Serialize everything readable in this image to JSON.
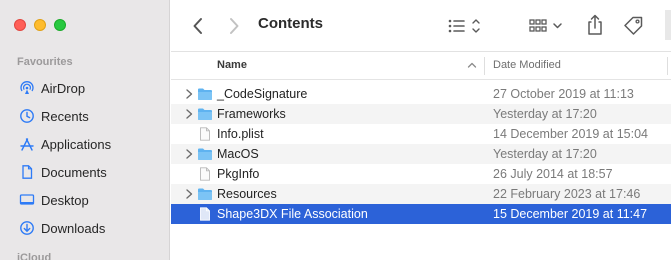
{
  "sidebar": {
    "section_title": "Favourites",
    "items": [
      {
        "label": "AirDrop",
        "icon": "airdrop-icon"
      },
      {
        "label": "Recents",
        "icon": "clock-icon"
      },
      {
        "label": "Applications",
        "icon": "applications-icon"
      },
      {
        "label": "Documents",
        "icon": "document-icon"
      },
      {
        "label": "Desktop",
        "icon": "desktop-icon"
      },
      {
        "label": "Downloads",
        "icon": "download-icon"
      }
    ],
    "next_section_partial": "iCloud"
  },
  "toolbar": {
    "title": "Contents",
    "back_icon": "chevron-left-icon",
    "forward_icon": "chevron-right-icon",
    "view_icon": "list-view-icon",
    "group_icon": "grid-group-icon",
    "share_icon": "share-icon",
    "tag_icon": "tag-icon"
  },
  "columns": {
    "name": "Name",
    "date": "Date Modified"
  },
  "colors": {
    "selection": "#2c62d8",
    "folder": "#5fb3f0",
    "accent": "#2e7bf6"
  },
  "files": [
    {
      "name": "_CodeSignature",
      "date": "27 October 2019 at 11:13",
      "kind": "folder",
      "expandable": true
    },
    {
      "name": "Frameworks",
      "date": "Yesterday at 17:20",
      "kind": "folder",
      "expandable": true
    },
    {
      "name": "Info.plist",
      "date": "14 December 2019 at 15:04",
      "kind": "file",
      "expandable": false
    },
    {
      "name": "MacOS",
      "date": "Yesterday at 17:20",
      "kind": "folder",
      "expandable": true
    },
    {
      "name": "PkgInfo",
      "date": "26 July 2014 at 18:57",
      "kind": "file",
      "expandable": false
    },
    {
      "name": "Resources",
      "date": "22 February 2023 at 17:46",
      "kind": "folder",
      "expandable": true
    },
    {
      "name": "Shape3DX File Association",
      "date": "15 December 2019 at 11:47",
      "kind": "file",
      "expandable": false,
      "selected": true
    }
  ]
}
